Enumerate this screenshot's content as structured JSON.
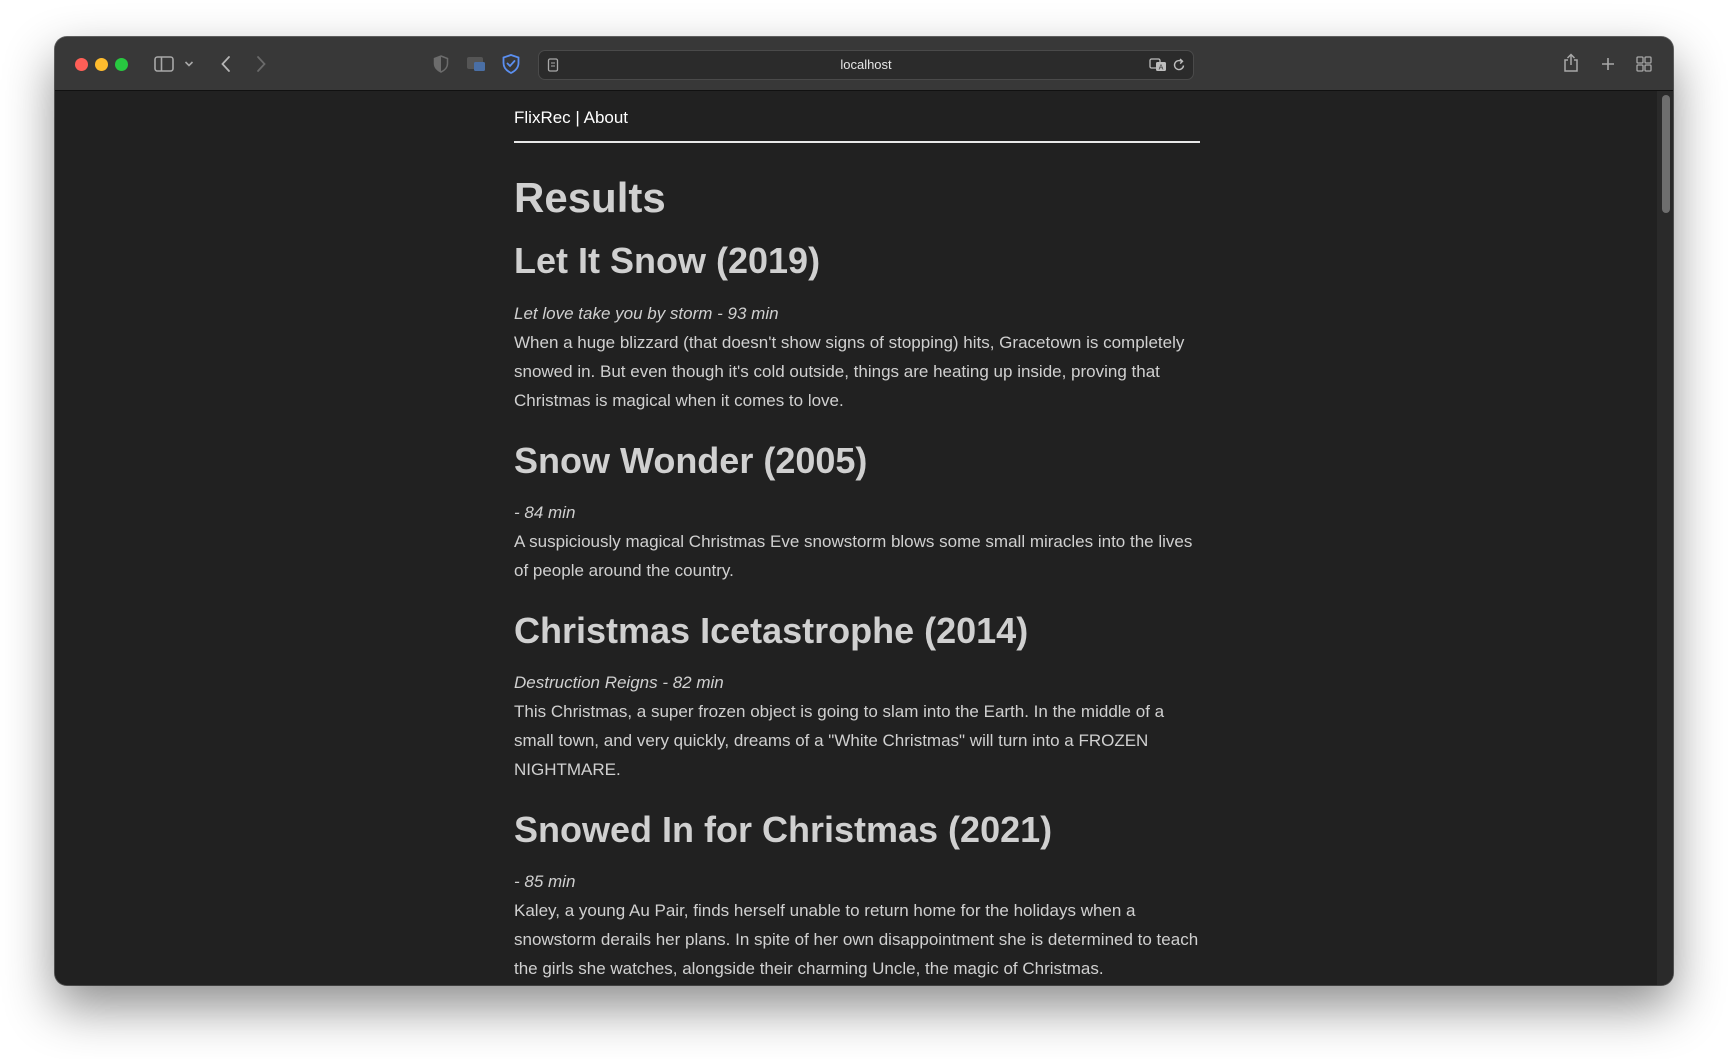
{
  "browser": {
    "address": "localhost",
    "icons": {
      "sidebar": "sidebar-icon",
      "back": "chevron-left-icon",
      "forward": "chevron-right-icon",
      "privacy": "shield-icon",
      "share": "share-icon",
      "new_tab": "plus-icon",
      "tab_overview": "grid-icon"
    }
  },
  "nav": {
    "brand": "FlixRec",
    "separator": " | ",
    "about": "About"
  },
  "page": {
    "title": "Results"
  },
  "movies": [
    {
      "title": "Let It Snow (2019)",
      "meta": "Let love take you by storm - 93 min",
      "description": "When a huge blizzard (that doesn't show signs of stopping) hits, Gracetown is completely snowed in. But even though it's cold outside, things are heating up inside, proving that Christmas is magical when it comes to love."
    },
    {
      "title": "Snow Wonder (2005)",
      "meta": " - 84 min",
      "description": "A suspiciously magical Christmas Eve snowstorm blows some small miracles into the lives of people around the country."
    },
    {
      "title": "Christmas Icetastrophe (2014)",
      "meta": "Destruction Reigns - 82 min",
      "description": "This Christmas, a super frozen object is going to slam into the Earth. In the middle of a small town, and very quickly, dreams of a \"White Christmas\" will turn into a FROZEN NIGHTMARE."
    },
    {
      "title": "Snowed In for Christmas (2021)",
      "meta": " - 85 min",
      "description": "Kaley, a young Au Pair, finds herself unable to return home for the holidays when a snowstorm derails her plans. In spite of her own disappointment she is determined to teach the girls she watches, alongside their charming Uncle, the magic of Christmas."
    }
  ]
}
